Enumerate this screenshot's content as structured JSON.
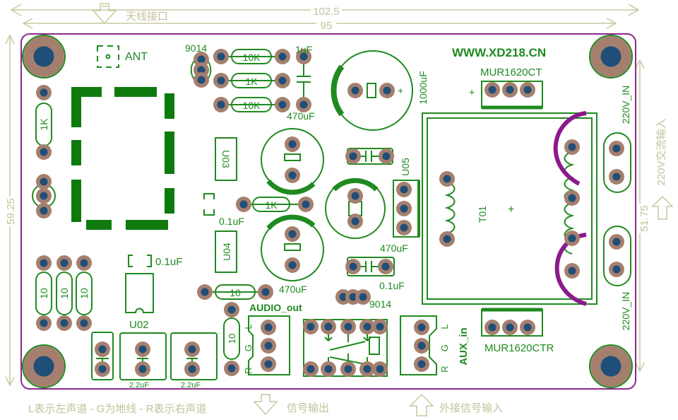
{
  "dimensions": {
    "top_outer": "102.5",
    "top_inner": "95",
    "left": "59.25",
    "right": "51.75"
  },
  "annotations": {
    "antenna_port": "天线接口",
    "legend": "L表示左声道 - G为地线 - R表示右声道",
    "signal_out": "信号输出",
    "signal_in": "外接信号输入",
    "ac_input": "220V交流输入"
  },
  "board": {
    "website": "WWW.XD218.CN",
    "ant": "ANT",
    "r_1k_left": "1K",
    "r_10_a": "10",
    "r_10_b": "10",
    "r_10_c": "10",
    "u02": "U02",
    "c_u02": "0.1uF",
    "c_bot_1": "2.2uF",
    "c_bot_2": "2.2uF",
    "q1": "9014",
    "r_10k_1": "10K",
    "r_1k_mid": "1K",
    "r_10k_2": "10K",
    "c_1uf": "1uF",
    "c_1000uf": "1000uF",
    "u03": "U03",
    "c_470uf_1": "470uF",
    "r_1k_2": "1K",
    "c_01uf_mid": "0.1uF",
    "u04": "U04",
    "c_470uf_2": "470uF",
    "r_10_mid": "10",
    "q2": "9014",
    "u05": "U05",
    "c_470uf_3": "470uF",
    "c_01uf_right": "0.1uF",
    "audio_out": "AUDIO_out",
    "r_10_vert": "10",
    "aux_in": "AUX_in",
    "pin_l": "L",
    "pin_g": "G",
    "pin_r": "R",
    "mur_top": "MUR1620CT",
    "mur_bot": "MUR1620CTR",
    "plus": "+",
    "t01": "T01",
    "ac_in_1": "220V_IN",
    "ac_in_2": "220V_IN"
  }
}
